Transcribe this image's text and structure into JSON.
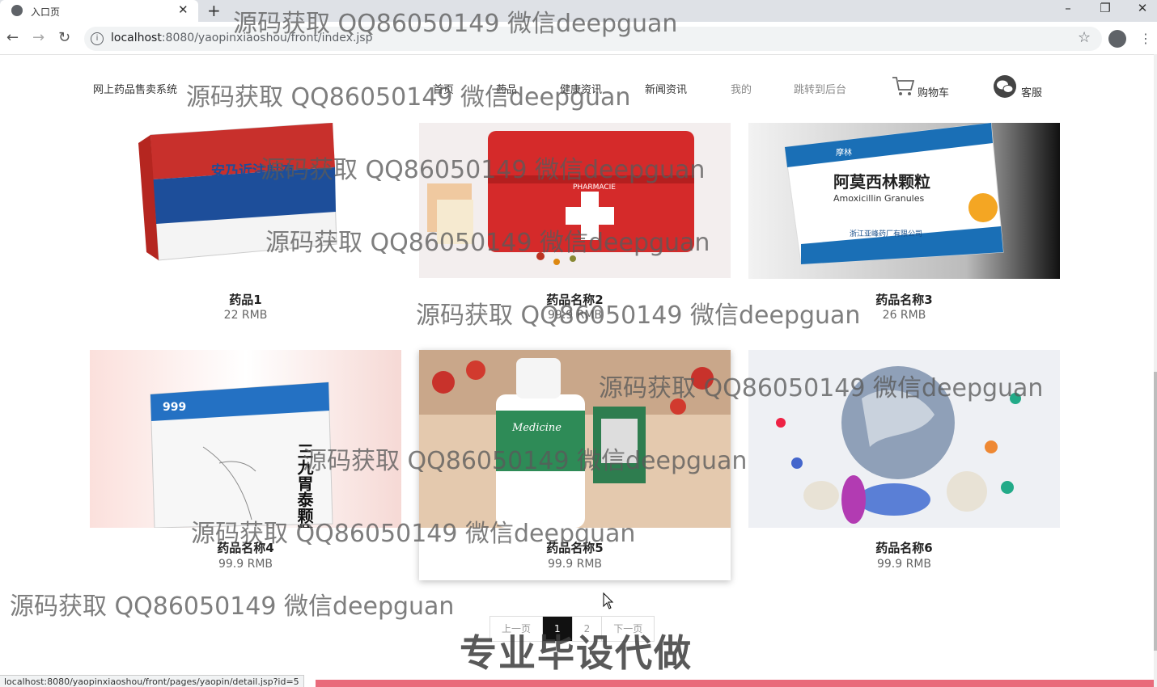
{
  "browser": {
    "tab_title": "入口页",
    "tab_close": "✕",
    "new_tab": "+",
    "url_host": "localhost",
    "url_rest": ":8080/yaopinxiaoshou/front/index.jsp",
    "status_url": "localhost:8080/yaopinxiaoshou/front/pages/yaopin/detail.jsp?id=5",
    "window_minimize": "–",
    "window_restore": "❐",
    "window_close": "✕"
  },
  "nav": {
    "brand": "网上药品售卖系统",
    "items": [
      "首页",
      "药品",
      "健康资讯",
      "新闻资讯",
      "我的",
      "跳转到后台"
    ],
    "cart_label": "购物车",
    "service_label": "客服"
  },
  "products": [
    {
      "name": "药品1",
      "price": "22 RMB"
    },
    {
      "name": "药品名称2",
      "price": "99.9 RMB"
    },
    {
      "name": "药品名称3",
      "price": "26 RMB"
    },
    {
      "name": "药品名称4",
      "price": "99.9 RMB"
    },
    {
      "name": "药品名称5",
      "price": "99.9 RMB"
    },
    {
      "name": "药品名称6",
      "price": "99.9 RMB"
    }
  ],
  "pagination": {
    "prev": "上一页",
    "pages": [
      "1",
      "2"
    ],
    "next": "下一页",
    "current": "1"
  },
  "watermarks": {
    "qq": "源码获取 QQ86050149 微信deepguan",
    "big": "专业毕设代做"
  },
  "product_images": {
    "p1_box_text": "安乃近注射液",
    "p3_box_title": "阿莫西林颗粒",
    "p3_box_sub": "Amoxicillin Granules",
    "p3_brand": "摩林",
    "p3_maker": "浙江亚峰药厂有限公司",
    "p4_box_text": "三九胃泰颗粒",
    "p4_brand": "999",
    "p5_label": "Medicine",
    "p2_case_text": "PHARMACIE"
  },
  "colors": {
    "accent": "#e96b7b",
    "active_page": "#111111"
  }
}
